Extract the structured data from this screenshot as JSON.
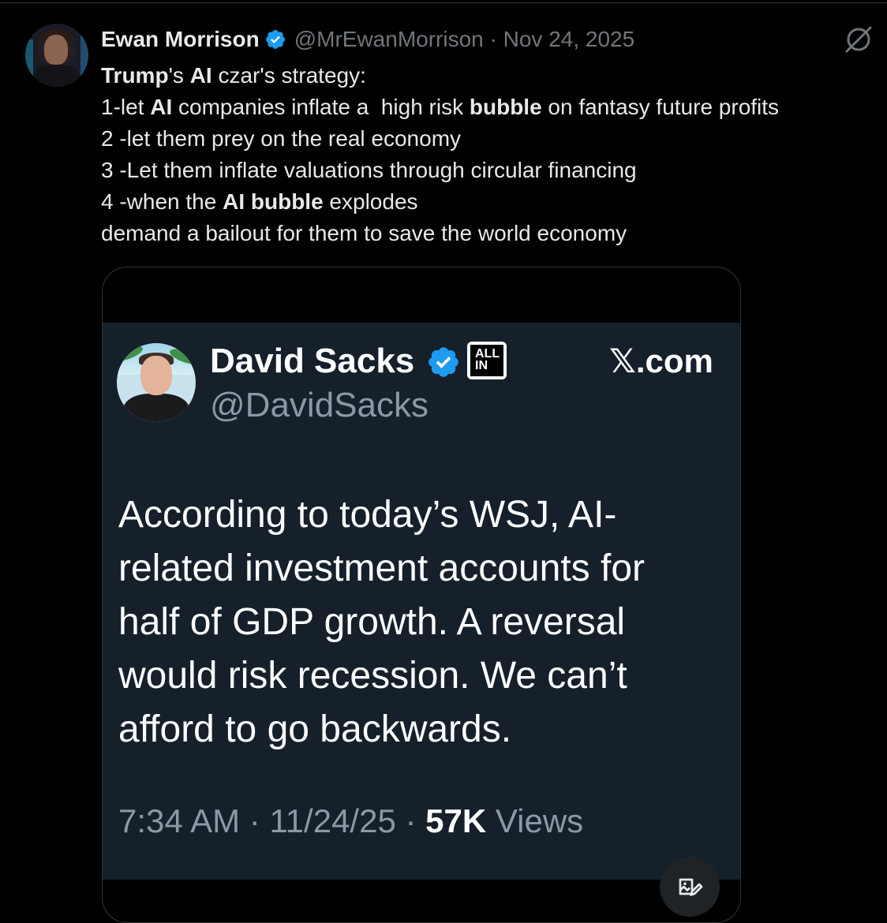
{
  "post": {
    "author": {
      "name": "Ewan Morrison",
      "handle": "@MrEwanMorrison",
      "date": "Nov 24, 2025",
      "verified": true
    },
    "meta_separator": " · ",
    "text_lines": [
      [
        {
          "t": "Trump",
          "b": true
        },
        {
          "t": "'s ",
          "b": false
        },
        {
          "t": "AI",
          "b": true
        },
        {
          "t": " czar's strategy:",
          "b": false
        }
      ],
      [
        {
          "t": "1-let ",
          "b": false
        },
        {
          "t": "AI",
          "b": true
        },
        {
          "t": " companies inflate a  high risk ",
          "b": false
        },
        {
          "t": "bubble",
          "b": true
        },
        {
          "t": " on fantasy future profits",
          "b": false
        }
      ],
      [
        {
          "t": "2 -let them prey on the real economy",
          "b": false
        }
      ],
      [
        {
          "t": "3 -Let them inflate valuations through circular financing",
          "b": false
        }
      ],
      [
        {
          "t": "4 -when the ",
          "b": false
        },
        {
          "t": "AI bubble",
          "b": true
        },
        {
          "t": " explodes",
          "b": false
        }
      ],
      [
        {
          "t": "demand a bailout for them to save the world economy",
          "b": false
        }
      ]
    ]
  },
  "embedded": {
    "name": "David Sacks",
    "handle": "@DavidSacks",
    "badge_line1": "ALL",
    "badge_line2": "IN",
    "site": "𝕏.com",
    "text_lines": [
      "According to today’s WSJ, AI-",
      "related investment accounts for",
      "half of GDP growth. A reversal",
      "would risk recession. We can’t",
      "afford to go backwards."
    ],
    "time": "7:34 AM",
    "date": "11/24/25",
    "views_count": "57K",
    "views_label": "Views",
    "separator": " · "
  },
  "colors": {
    "background": "#000000",
    "text": "#e7e9ea",
    "muted": "#71767b",
    "verified_blue": "#1d9bf0",
    "card_bg": "#15202b"
  },
  "icons": [
    "verified-badge-icon",
    "grok-icon",
    "image-edit-icon"
  ]
}
